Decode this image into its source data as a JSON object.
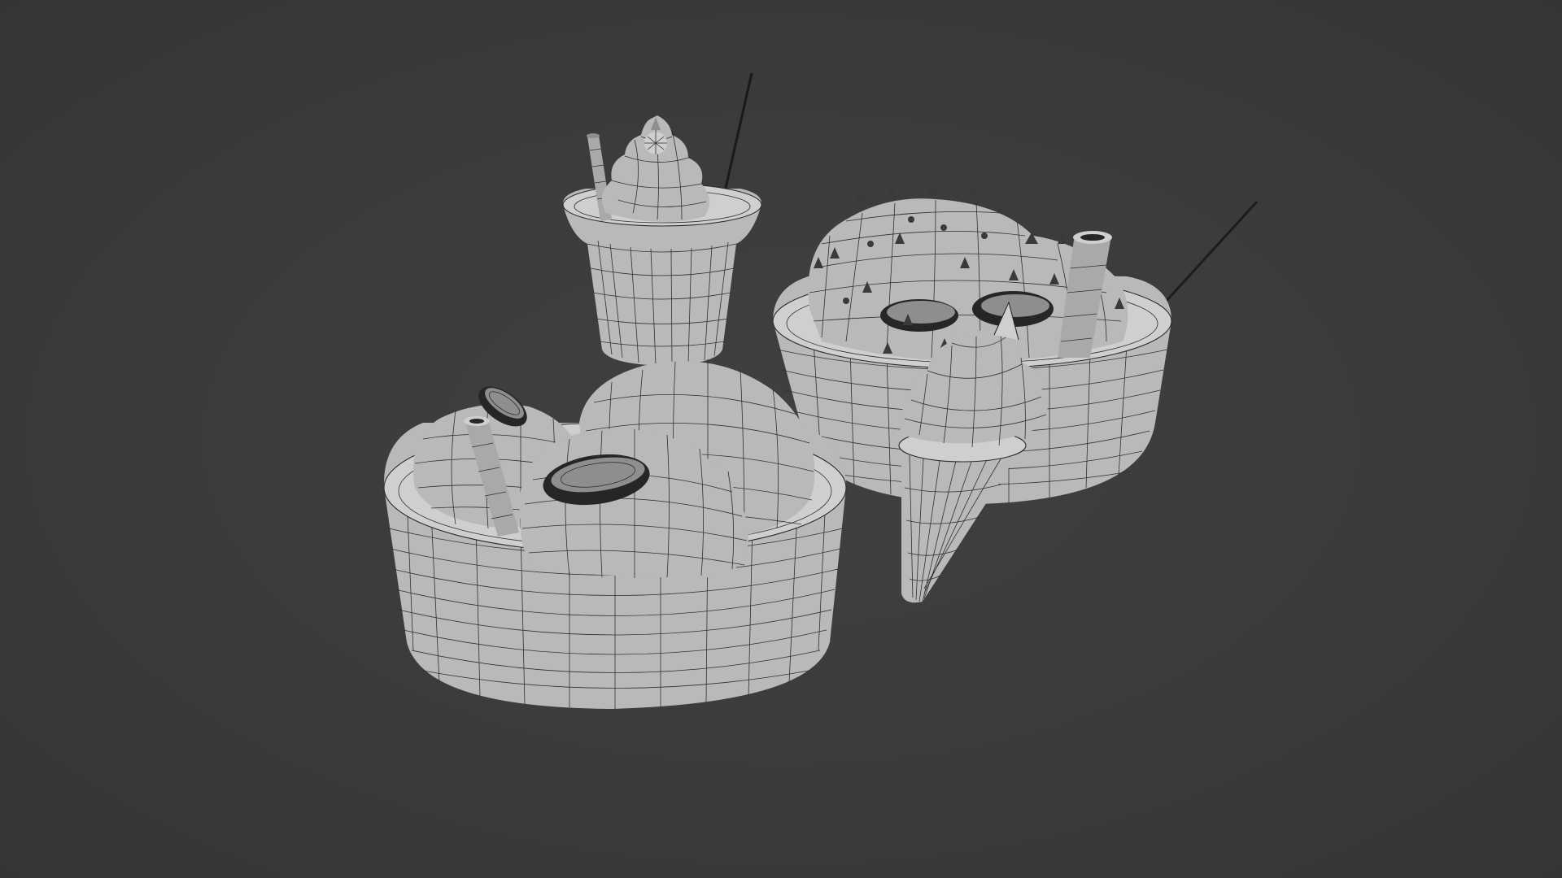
{
  "viewport": {
    "mode": "solid-wireframe",
    "background_color": "#3a3a3a"
  },
  "scene": {
    "objects": [
      {
        "name": "glass-sundae",
        "kind": "tall glass with soft-serve, straw and stick"
      },
      {
        "name": "bowl-right",
        "kind": "bowl with scoops, sprinkles, wafer roll and stick"
      },
      {
        "name": "bowl-front",
        "kind": "bowl with three scoops, cookies and wafer roll"
      },
      {
        "name": "cone",
        "kind": "soft-serve ice cream cone"
      }
    ]
  },
  "colors": {
    "mesh": "#b9b9b9",
    "wire": "#2b2b2b",
    "background": "#3a3a3a"
  }
}
